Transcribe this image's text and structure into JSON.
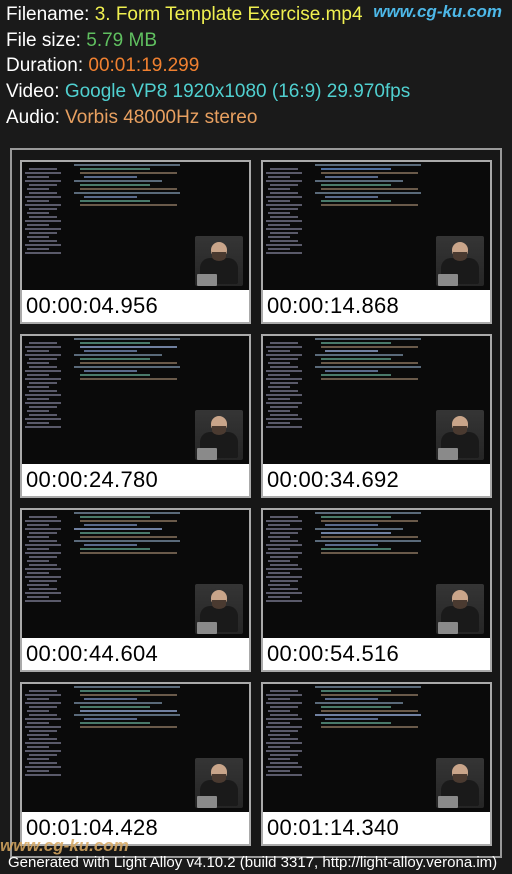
{
  "watermarks": {
    "top": "www.cg-ku.com",
    "bottom": "www.cg-ku.com"
  },
  "info": {
    "filename_label": "Filename: ",
    "filename_value": "3. Form Template Exercise.mp4",
    "filesize_label": "File size: ",
    "filesize_value": "5.79 MB",
    "duration_label": "Duration: ",
    "duration_value": "00:01:19.299",
    "video_label": "Video: ",
    "video_value": "Google VP8 1920x1080 (16:9) 29.970fps",
    "audio_label": "Audio: ",
    "audio_value": "Vorbis 48000Hz stereo"
  },
  "thumbs": [
    {
      "time": "00:00:04.956"
    },
    {
      "time": "00:00:14.868"
    },
    {
      "time": "00:00:24.780"
    },
    {
      "time": "00:00:34.692"
    },
    {
      "time": "00:00:44.604"
    },
    {
      "time": "00:00:54.516"
    },
    {
      "time": "00:01:04.428"
    },
    {
      "time": "00:01:14.340"
    }
  ],
  "footer": "Generated with Light Alloy v4.10.2 (build 3317, http://light-alloy.verona.im)"
}
